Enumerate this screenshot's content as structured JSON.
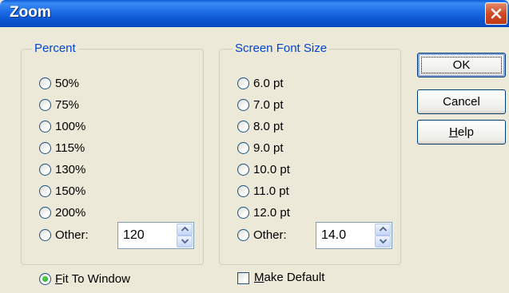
{
  "window": {
    "title": "Zoom"
  },
  "percent": {
    "legend": "Percent",
    "options": [
      "50%",
      "75%",
      "100%",
      "115%",
      "130%",
      "150%",
      "200%"
    ],
    "other_label": "Other:",
    "other_value": "120"
  },
  "font_size": {
    "legend": "Screen Font Size",
    "options": [
      "6.0 pt",
      "7.0 pt",
      "8.0 pt",
      "9.0 pt",
      "10.0 pt",
      "11.0 pt",
      "12.0 pt"
    ],
    "other_label": "Other:",
    "other_value": "14.0"
  },
  "buttons": {
    "ok": "OK",
    "cancel": "Cancel",
    "help_prefix": "",
    "help_underline": "H",
    "help_rest": "elp"
  },
  "fit_to_window": {
    "underline": "F",
    "rest": "it To Window",
    "selected": true
  },
  "make_default": {
    "underline": "M",
    "rest": "ake Default",
    "checked": false
  },
  "icons": {
    "close": "close-icon",
    "spin_up": "spin-up-icon",
    "spin_down": "spin-down-icon"
  }
}
